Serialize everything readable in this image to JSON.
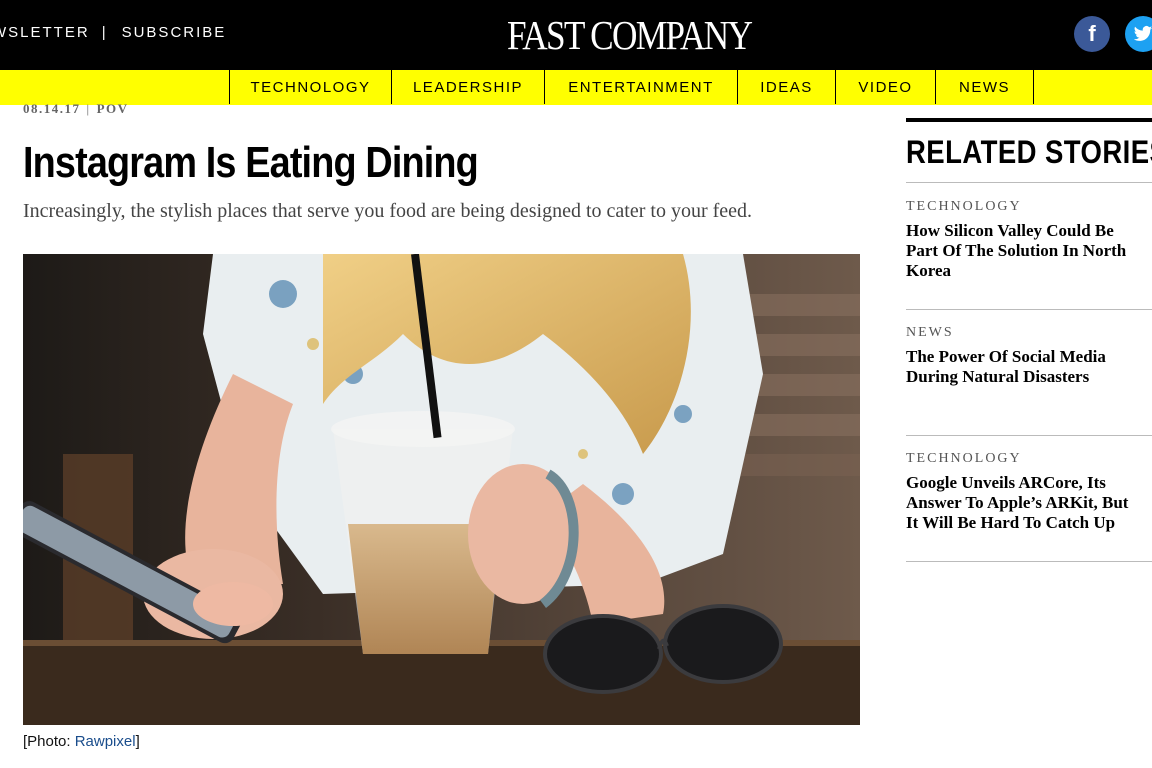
{
  "header": {
    "newsletter_label": "WSLETTER",
    "separator": "|",
    "subscribe_label": "SUBSCRIBE",
    "logo_text": "FAST COMPANY",
    "facebook_glyph": "f",
    "twitter_glyph": "🐦",
    "background": "#000000"
  },
  "nav": {
    "background": "#ffff00",
    "items": [
      {
        "label": "TECHNOLOGY"
      },
      {
        "label": "LEADERSHIP"
      },
      {
        "label": "ENTERTAINMENT"
      },
      {
        "label": "IDEAS"
      },
      {
        "label": "VIDEO"
      },
      {
        "label": "NEWS"
      }
    ]
  },
  "article": {
    "date": "08.14.17",
    "meta_separator": "|",
    "section": "POV",
    "headline": "Instagram Is Eating Dining",
    "dek": "Increasingly, the stylish places that serve you food are being designed to cater to your feed.",
    "caption": {
      "prefix": "[Photo: ",
      "credit": "Rawpixel",
      "suffix": "]"
    }
  },
  "sidebar": {
    "title": "RELATED STORIES",
    "stories": [
      {
        "category": "TECHNOLOGY",
        "title": "How Silicon Valley Could Be\nPart Of The Solution In North\nKorea"
      },
      {
        "category": "NEWS",
        "title": "The Power Of Social Media\nDuring Natural Disasters"
      },
      {
        "category": "TECHNOLOGY",
        "title": "Google Unveils ARCore, Its\nAnswer To Apple’s ARKit, But\nIt Will Be Hard To Catch Up"
      }
    ]
  },
  "icons": {
    "facebook": "facebook-icon",
    "twitter": "twitter-icon"
  }
}
